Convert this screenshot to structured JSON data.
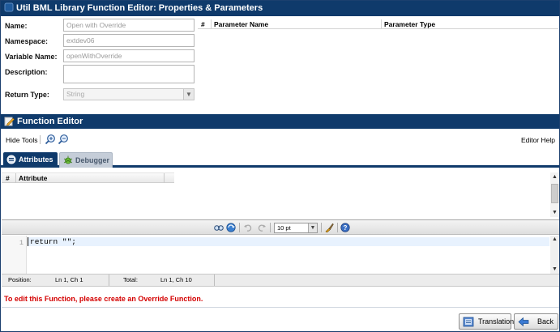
{
  "window": {
    "title": "Util BML Library Function Editor: Properties & Parameters"
  },
  "properties": {
    "name": {
      "label": "Name:",
      "value": "Open with Override"
    },
    "namespace": {
      "label": "Namespace:",
      "value": "extdev06"
    },
    "variable_name": {
      "label": "Variable Name:",
      "value": "openWithOverride"
    },
    "description": {
      "label": "Description:",
      "value": ""
    },
    "return_type": {
      "label": "Return Type:",
      "value": "String"
    }
  },
  "parameters_table": {
    "columns": [
      "#",
      "Parameter Name",
      "Parameter Type"
    ]
  },
  "function_editor": {
    "title": "Function Editor",
    "hide_tools": "Hide Tools",
    "editor_help": "Editor Help",
    "tabs": [
      {
        "label": "Attributes",
        "active": true
      },
      {
        "label": "Debugger",
        "active": false
      }
    ],
    "attribute_grid": {
      "columns": [
        "#",
        "Attribute"
      ]
    },
    "code_toolbar": {
      "font_size": "10 pt"
    },
    "code": {
      "line_numbers": [
        "1"
      ],
      "lines": [
        "return \"\";"
      ]
    },
    "status": {
      "position_label": "Position:",
      "position_value": "Ln 1, Ch 1",
      "total_label": "Total:",
      "total_value": "Ln 1, Ch 10"
    }
  },
  "override_message": "To edit this Function, please create an Override Function.",
  "buttons": {
    "translations": "Translations",
    "back": "Back"
  },
  "colors": {
    "header_blue": "#0f3a6b",
    "warning_red": "#d40000"
  }
}
